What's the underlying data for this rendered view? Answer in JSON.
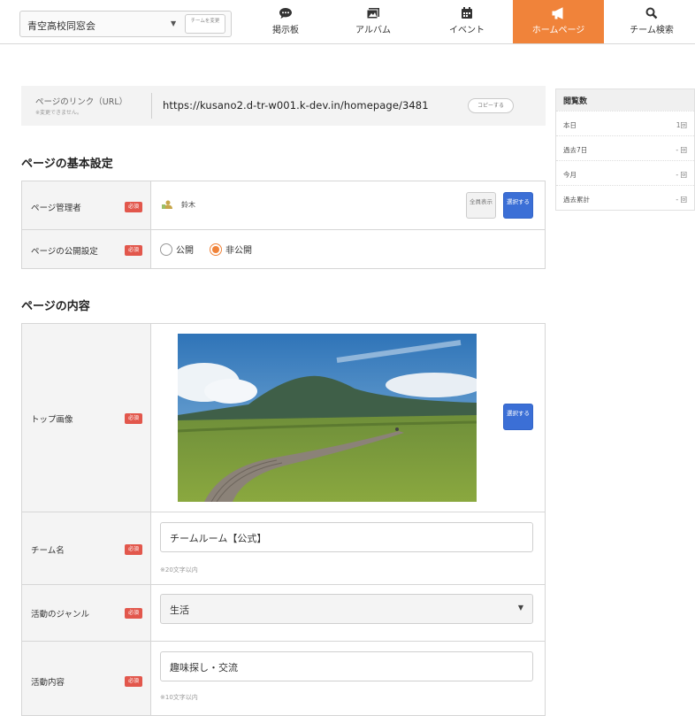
{
  "topnav": {
    "team_name": "青空高校同窓会",
    "change_team_button": "チームを変更",
    "items": [
      {
        "label": "掲示板",
        "icon": "speech-bubble-icon"
      },
      {
        "label": "アルバム",
        "icon": "album-icon"
      },
      {
        "label": "イベント",
        "icon": "calendar-icon"
      },
      {
        "label": "ホームページ",
        "icon": "megaphone-icon",
        "active": true
      },
      {
        "label": "チーム検索",
        "icon": "search-icon"
      }
    ],
    "accent_color": "#f0833a"
  },
  "url_section": {
    "label": "ページのリンク（URL）",
    "note": "※変更できません。",
    "url": "https://kusano2.d-tr-w001.k-dev.in/homepage/3481",
    "copy_button": "コピーする"
  },
  "basic_settings": {
    "title": "ページの基本設定",
    "required_badge": "必須",
    "admin": {
      "label": "ページ管理者",
      "value": "鈴木",
      "show_all_button": "全員表示",
      "select_button": "選択する"
    },
    "visibility": {
      "label": "ページの公開設定",
      "options": [
        "公開",
        "非公開"
      ],
      "selected": "非公開"
    }
  },
  "content": {
    "title": "ページの内容",
    "top_image": {
      "label": "トップ画像",
      "select_button": "選択する"
    },
    "team_name": {
      "label": "チーム名",
      "value": "チームルーム【公式】",
      "hint": "※20文字以内"
    },
    "genre": {
      "label": "活動のジャンル",
      "selected": "生活"
    },
    "activity": {
      "label": "活動内容",
      "value": "趣味探し・交流",
      "hint": "※10文字以内"
    }
  },
  "stats": {
    "title": "閲覧数",
    "rows": [
      {
        "label": "本日",
        "value": "1回"
      },
      {
        "label": "過去7日",
        "value": "- 回"
      },
      {
        "label": "今月",
        "value": "- 回"
      },
      {
        "label": "過去累計",
        "value": "- 回"
      }
    ]
  }
}
